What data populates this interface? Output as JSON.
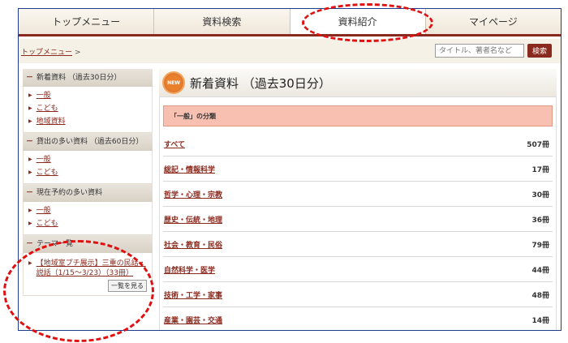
{
  "nav": {
    "tabs": [
      {
        "label": "トップメニュー"
      },
      {
        "label": "資料検索"
      },
      {
        "label": "資料紹介"
      },
      {
        "label": "マイページ"
      }
    ]
  },
  "breadcrumb": {
    "top": "トップメニュー",
    "sep": ">"
  },
  "search": {
    "placeholder": "タイトル、著者名など",
    "button": "検索"
  },
  "sidebar": {
    "new": {
      "title": "新着資料 （過去30日分）",
      "items": [
        "一般",
        "こども",
        "地域資料"
      ]
    },
    "popular": {
      "title": "貸出の多い資料 （過去60日分）",
      "items": [
        "一般",
        "こども"
      ]
    },
    "reserved": {
      "title": "現在予約の多い資料",
      "items": [
        "一般",
        "こども"
      ]
    },
    "theme": {
      "title": "テーマ一覧",
      "link": "【地域室プチ展示】三重の民話・説話（1/15～3/23）（33冊）",
      "button": "一覧を見る"
    }
  },
  "main": {
    "badge": "NEW",
    "title": "新着資料 （過去30日分）",
    "category": "「一般」の分類",
    "rows": [
      {
        "label": "すべて",
        "count": "507冊"
      },
      {
        "label": "総記・情報科学",
        "count": "17冊"
      },
      {
        "label": "哲学・心理・宗教",
        "count": "30冊"
      },
      {
        "label": "歴史・伝統・地理",
        "count": "36冊"
      },
      {
        "label": "社会・教育・民俗",
        "count": "79冊"
      },
      {
        "label": "自然科学・医学",
        "count": "44冊"
      },
      {
        "label": "技術・工学・家事",
        "count": "48冊"
      },
      {
        "label": "産業・園芸・交通",
        "count": "14冊"
      }
    ]
  },
  "colors": {
    "accent": "#8a2a1e",
    "annotation": "#e01010",
    "category_bar": "#f8c0b0"
  }
}
